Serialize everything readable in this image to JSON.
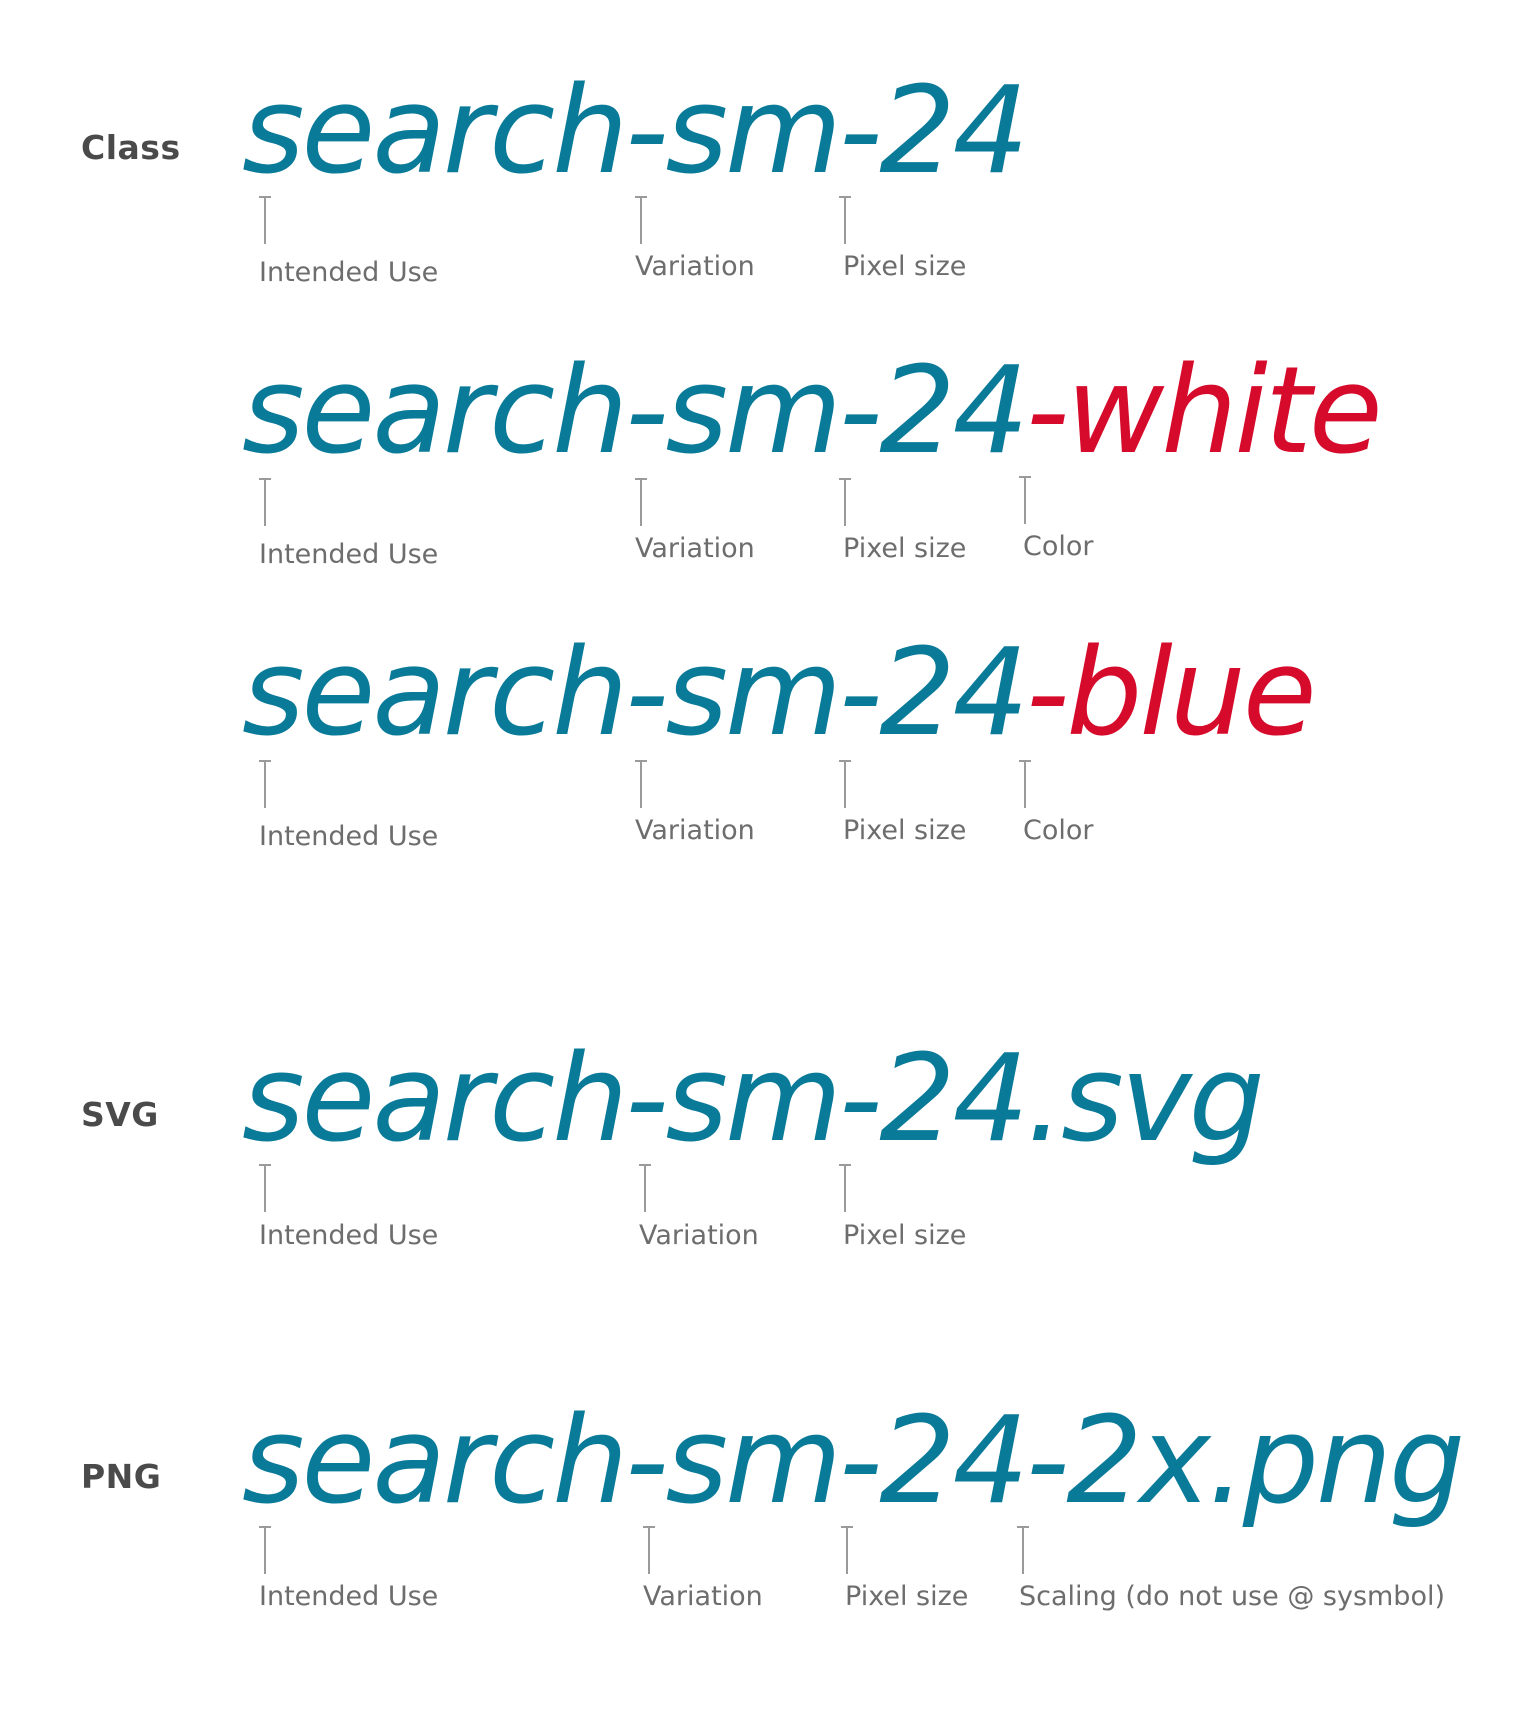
{
  "colors": {
    "name_blue": "#0a7a99",
    "accent_red": "#d60b2b",
    "label_gray": "#4a4a4a",
    "note_gray": "#6d6d6d",
    "marker_gray": "#9a9a9a"
  },
  "labels": {
    "class": "Class",
    "svg": "SVG",
    "png": "PNG"
  },
  "rows": [
    {
      "name_main": "search-sm-24",
      "name_suffix": "",
      "annotations": [
        "Intended Use",
        "Variation",
        "Pixel size"
      ]
    },
    {
      "name_main": "search-sm-24",
      "name_suffix": "-white",
      "annotations": [
        "Intended Use",
        "Variation",
        "Pixel size",
        "Color"
      ]
    },
    {
      "name_main": "search-sm-24",
      "name_suffix": "-blue",
      "annotations": [
        "Intended Use",
        "Variation",
        "Pixel size",
        "Color"
      ]
    },
    {
      "name_main": "search-sm-24.svg",
      "name_suffix": "",
      "annotations": [
        "Intended Use",
        "Variation",
        "Pixel size"
      ]
    },
    {
      "name_main": "search-sm-24-2x.png",
      "name_suffix": "",
      "annotations": [
        "Intended Use",
        "Variation",
        "Pixel size",
        "Scaling (do not use @ sysmbol)"
      ]
    }
  ]
}
